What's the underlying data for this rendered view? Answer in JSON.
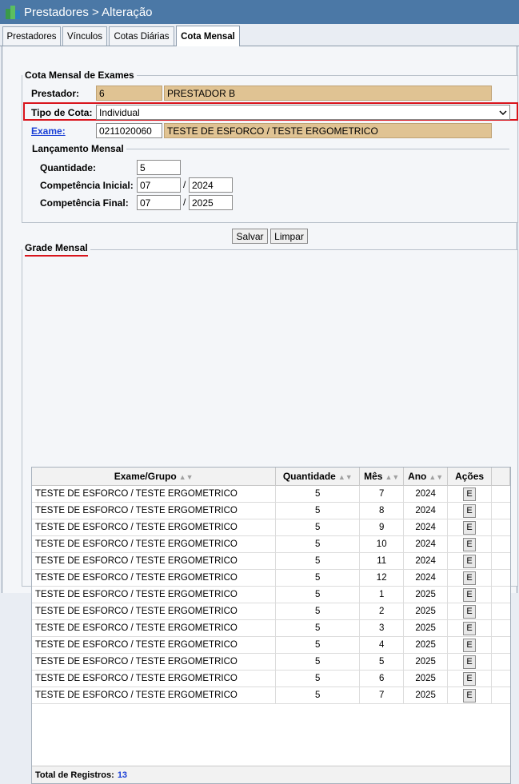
{
  "window": {
    "title": "Prestadores > Alteração"
  },
  "tabs": [
    {
      "label": "Prestadores"
    },
    {
      "label": "Vínculos"
    },
    {
      "label": "Cotas Diárias"
    },
    {
      "label": "Cota Mensal"
    }
  ],
  "cota_mensal": {
    "legend": "Cota Mensal de Exames",
    "prestador_label": "Prestador:",
    "prestador_code": "6",
    "prestador_name": "PRESTADOR B",
    "tipo_label": "Tipo de Cota:",
    "tipo_value": "Individual",
    "exame_label": "Exame:",
    "exame_code": "0211020060",
    "exame_name": "TESTE DE ESFORCO / TESTE ERGOMETRICO"
  },
  "lancamento": {
    "legend": "Lançamento Mensal",
    "quantidade_label": "Quantidade:",
    "quantidade": "5",
    "inicial_label": "Competência Inicial:",
    "inicial_mes": "07",
    "inicial_ano": "2024",
    "final_label": "Competência Final:",
    "final_mes": "07",
    "final_ano": "2025",
    "slash": "/"
  },
  "buttons": {
    "salvar": "Salvar",
    "limpar": "Limpar"
  },
  "grade": {
    "legend": "Grade Mensal",
    "headers": {
      "exame": "Exame/Grupo",
      "quantidade": "Quantidade",
      "mes": "Mês",
      "ano": "Ano",
      "acoes": "Ações"
    },
    "edit_label": "E",
    "rows": [
      {
        "exame": "TESTE DE ESFORCO / TESTE ERGOMETRICO",
        "quantidade": "5",
        "mes": "7",
        "ano": "2024"
      },
      {
        "exame": "TESTE DE ESFORCO / TESTE ERGOMETRICO",
        "quantidade": "5",
        "mes": "8",
        "ano": "2024"
      },
      {
        "exame": "TESTE DE ESFORCO / TESTE ERGOMETRICO",
        "quantidade": "5",
        "mes": "9",
        "ano": "2024"
      },
      {
        "exame": "TESTE DE ESFORCO / TESTE ERGOMETRICO",
        "quantidade": "5",
        "mes": "10",
        "ano": "2024"
      },
      {
        "exame": "TESTE DE ESFORCO / TESTE ERGOMETRICO",
        "quantidade": "5",
        "mes": "11",
        "ano": "2024"
      },
      {
        "exame": "TESTE DE ESFORCO / TESTE ERGOMETRICO",
        "quantidade": "5",
        "mes": "12",
        "ano": "2024"
      },
      {
        "exame": "TESTE DE ESFORCO / TESTE ERGOMETRICO",
        "quantidade": "5",
        "mes": "1",
        "ano": "2025"
      },
      {
        "exame": "TESTE DE ESFORCO / TESTE ERGOMETRICO",
        "quantidade": "5",
        "mes": "2",
        "ano": "2025"
      },
      {
        "exame": "TESTE DE ESFORCO / TESTE ERGOMETRICO",
        "quantidade": "5",
        "mes": "3",
        "ano": "2025"
      },
      {
        "exame": "TESTE DE ESFORCO / TESTE ERGOMETRICO",
        "quantidade": "5",
        "mes": "4",
        "ano": "2025"
      },
      {
        "exame": "TESTE DE ESFORCO / TESTE ERGOMETRICO",
        "quantidade": "5",
        "mes": "5",
        "ano": "2025"
      },
      {
        "exame": "TESTE DE ESFORCO / TESTE ERGOMETRICO",
        "quantidade": "5",
        "mes": "6",
        "ano": "2025"
      },
      {
        "exame": "TESTE DE ESFORCO / TESTE ERGOMETRICO",
        "quantidade": "5",
        "mes": "7",
        "ano": "2025"
      }
    ],
    "total_label": "Total de Registros:",
    "total_value": "13"
  },
  "icons": {
    "app": "buildings-logo-icon",
    "sort": "sort-arrows-icon",
    "dropdown": "chevron-down-icon"
  },
  "colors": {
    "titlebar": "#4b78a6",
    "readonly_field": "#e0c393",
    "highlight": "#d9141c",
    "link": "#1a3fd6"
  }
}
